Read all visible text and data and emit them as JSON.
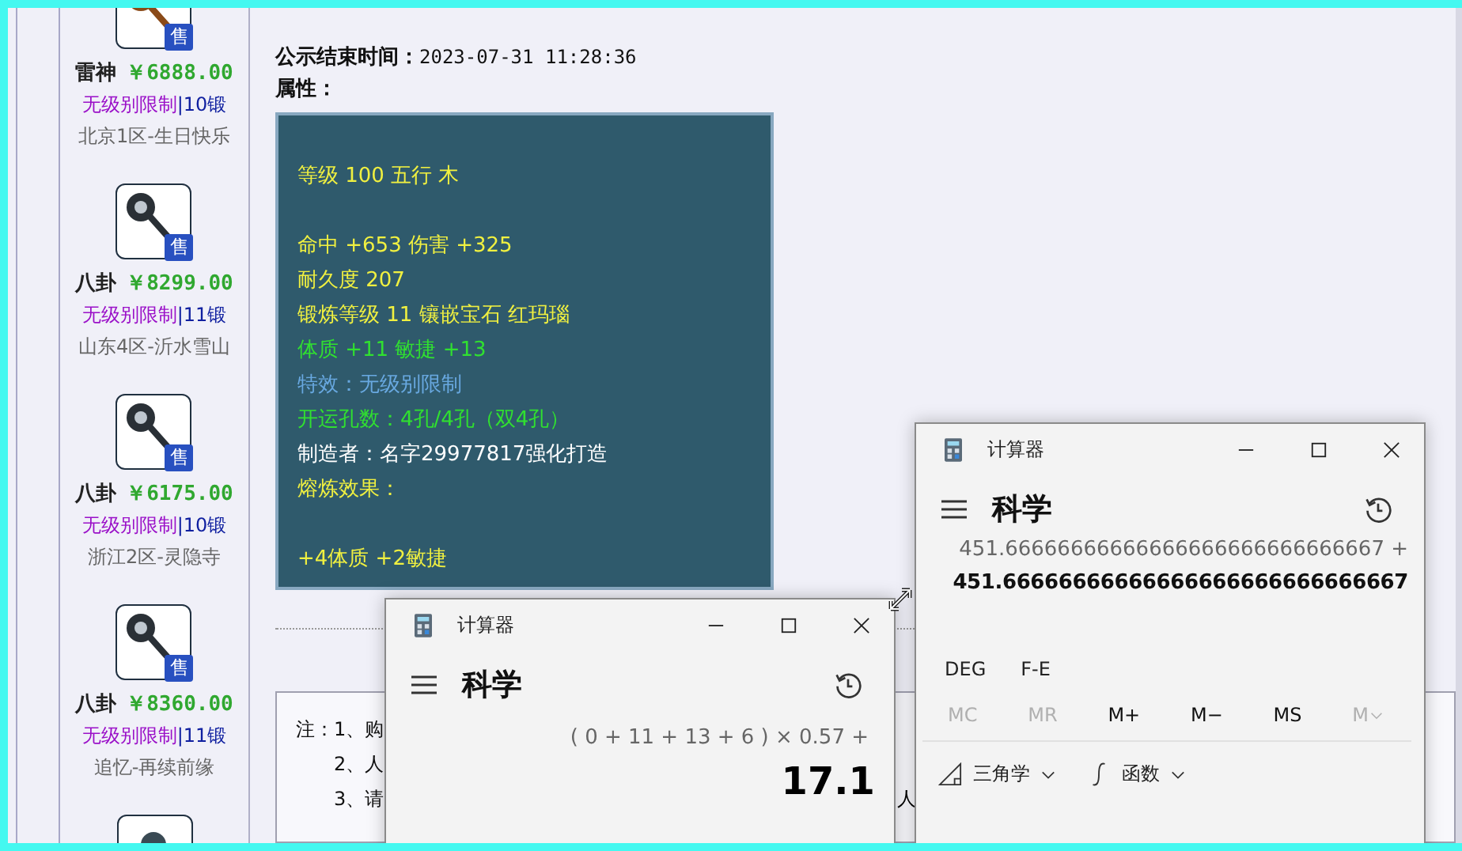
{
  "sidebar": {
    "items": [
      {
        "name": "雷神",
        "price": "￥6888.00",
        "limit": "无级别限制",
        "forge": "|10锻",
        "server": "北京1区-生日快乐",
        "badge": "售",
        "color": "#8a4a18"
      },
      {
        "name": "八卦",
        "price": "￥8299.00",
        "limit": "无级别限制",
        "forge": "|11锻",
        "server": "山东4区-沂水雪山",
        "badge": "售",
        "color": "#2a3036"
      },
      {
        "name": "八卦",
        "price": "￥6175.00",
        "limit": "无级别限制",
        "forge": "|10锻",
        "server": "浙江2区-灵隐寺",
        "badge": "售",
        "color": "#2a3036"
      },
      {
        "name": "八卦",
        "price": "￥8360.00",
        "limit": "无级别限制",
        "forge": "|11锻",
        "server": "追忆-再续前缘",
        "badge": "售",
        "color": "#2a3036"
      },
      {
        "kind": "partial"
      }
    ]
  },
  "detail": {
    "fields": [
      {
        "label": "公示结束时间：",
        "value": "2023-07-31 11:28:36"
      },
      {
        "label": "属性："
      }
    ],
    "attributes": [
      {
        "kind": "gap"
      },
      {
        "kind": "line",
        "text": "等级 100 五行 木",
        "color": "#f0f040"
      },
      {
        "kind": "gap"
      },
      {
        "kind": "line",
        "text": "命中 +653 伤害 +325",
        "color": "#f0f040"
      },
      {
        "kind": "line",
        "text": "耐久度 207",
        "color": "#f0f040"
      },
      {
        "kind": "line",
        "text": "锻炼等级 11 镶嵌宝石 红玛瑙",
        "color": "#f0f040"
      },
      {
        "kind": "line",
        "text": "体质 +11 敏捷 +13",
        "color": "#30e030"
      },
      {
        "kind": "line",
        "text": "特效：无级别限制",
        "color": "#68a8e0"
      },
      {
        "kind": "line",
        "text": "开运孔数：4孔/4孔（双4孔）",
        "color": "#30e030"
      },
      {
        "kind": "line",
        "text": "制造者：名字29977817强化打造",
        "color": "#ffffff"
      },
      {
        "kind": "line",
        "text": "熔炼效果：",
        "color": "#f0f040"
      },
      {
        "kind": "gap"
      },
      {
        "kind": "line",
        "text": "+4体质 +2敏捷",
        "color": "#f0f040"
      }
    ],
    "notes": [
      "注：1、购",
      "2、人",
      "3、请"
    ],
    "notes_tail": "人"
  },
  "calculators": [
    {
      "kind": "compact",
      "title": "计算器",
      "mode": "科学",
      "expression": "( 0 + 11 + 13 + 6 ) × 0.57 +",
      "result": "17.1"
    },
    {
      "kind": "full",
      "title": "计算器",
      "mode": "科学",
      "expression": "451.66666666666666666666666666667 +",
      "result": "451.66666666666666666666666666667",
      "angle": [
        "DEG",
        "F-E"
      ],
      "memory": [
        {
          "label": "MC",
          "disabled": true
        },
        {
          "label": "MR",
          "disabled": true
        },
        {
          "label": "M+",
          "disabled": false
        },
        {
          "label": "M−",
          "disabled": false
        },
        {
          "label": "MS",
          "disabled": false
        },
        {
          "label": "M",
          "disabled": true
        }
      ],
      "menus": [
        {
          "label": "三角学",
          "kind": "trig"
        },
        {
          "label": "函数",
          "kind": "func"
        }
      ]
    }
  ]
}
